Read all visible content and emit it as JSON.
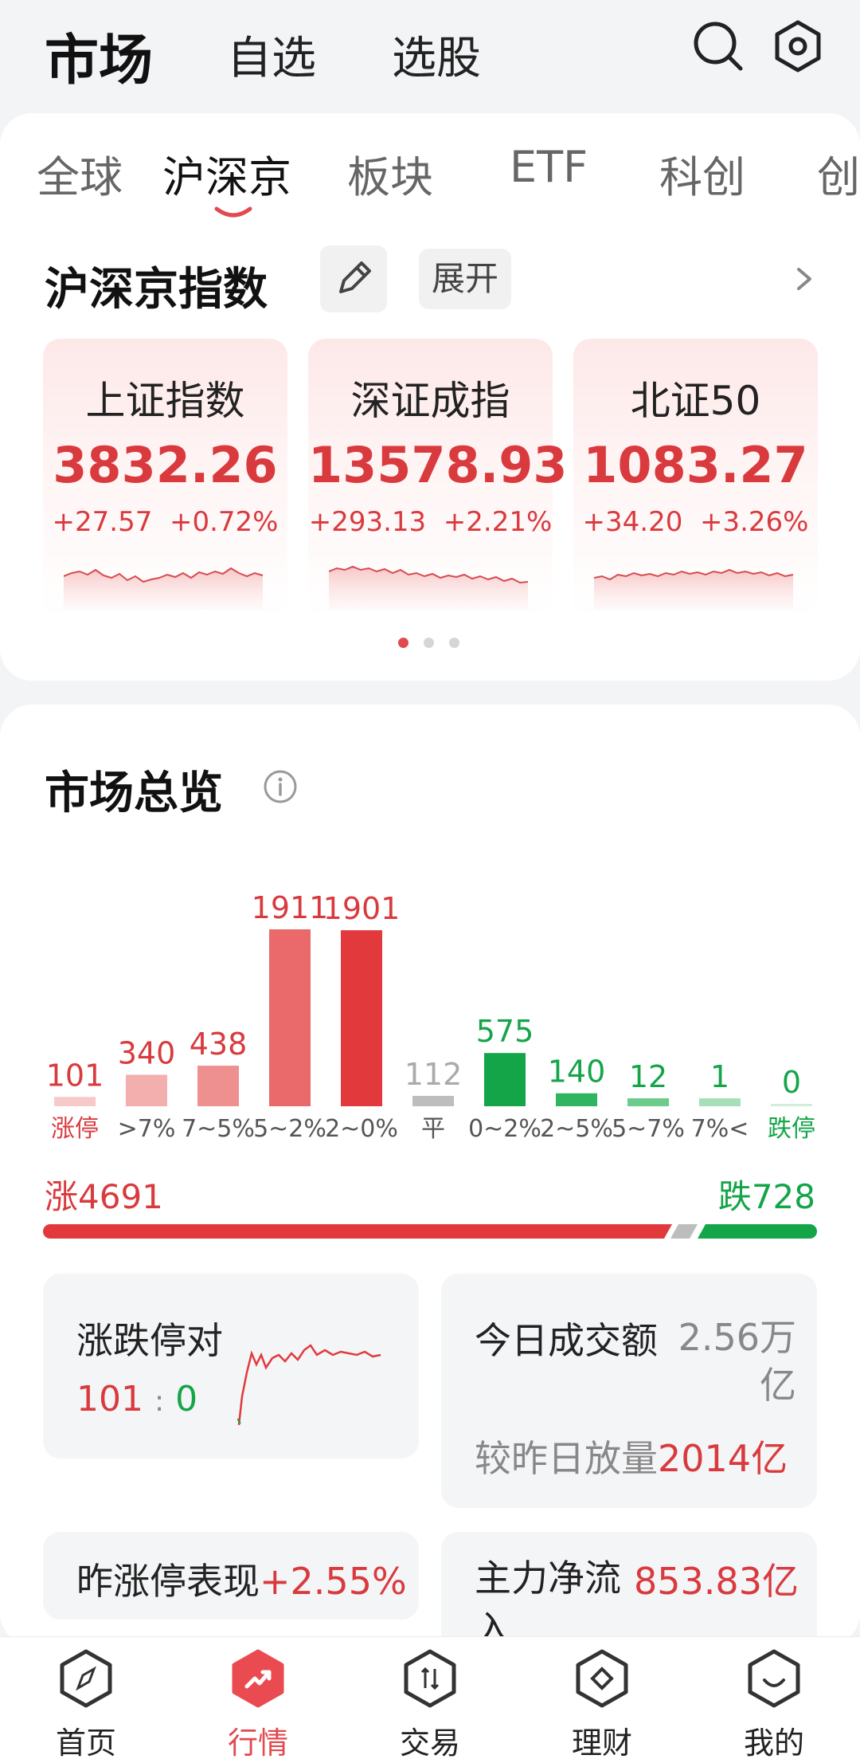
{
  "header": {
    "title": "市场",
    "nav": [
      "自选",
      "选股"
    ],
    "icons": [
      "search-icon",
      "settings-icon"
    ]
  },
  "tabs": [
    "全球",
    "沪深京",
    "板块",
    "ETF",
    "科创",
    "创"
  ],
  "active_tab": "沪深京",
  "index_section": {
    "title": "沪深京指数",
    "expand_label": "展开",
    "cards": [
      {
        "name": "上证指数",
        "value": "3832.26",
        "change": "+27.57",
        "pct": "+0.72%"
      },
      {
        "name": "深证成指",
        "value": "13578.93",
        "change": "+293.13",
        "pct": "+2.21%"
      },
      {
        "name": "北证50",
        "value": "1083.27",
        "change": "+34.20",
        "pct": "+3.26%"
      }
    ],
    "page_dots": 3,
    "active_dot": 0
  },
  "overview": {
    "title": "市场总览",
    "distribution": [
      {
        "label": "涨停",
        "value": "101",
        "color": "#f7c9c9"
      },
      {
        "label": ">7%",
        "value": "340",
        "color": "#f3aeae"
      },
      {
        "label": "7~5%",
        "value": "438",
        "color": "#ee8f90"
      },
      {
        "label": "5~2%",
        "value": "1911",
        "color": "#ea6a6c"
      },
      {
        "label": "2~0%",
        "value": "1901",
        "color": "#e2393d"
      },
      {
        "label": "平",
        "value": "112",
        "color": "#bdbdbd"
      },
      {
        "label": "0~2%",
        "value": "575",
        "color": "#14a549"
      },
      {
        "label": "2~5%",
        "value": "140",
        "color": "#2fb560"
      },
      {
        "label": "5~7%",
        "value": "12",
        "color": "#6ccc8c"
      },
      {
        "label": "7%<",
        "value": "1",
        "color": "#a6e0b9"
      },
      {
        "label": "跌停",
        "value": "0",
        "color": "#cfeed9"
      }
    ],
    "up_label": "涨4691",
    "down_label": "跌728",
    "limit_card": {
      "title": "涨跌停对",
      "up": "101",
      "sep": ":",
      "down": "0"
    },
    "turnover_card": {
      "title": "今日成交额",
      "value": "2.56万亿",
      "compare_label": "较昨日放量",
      "compare_value": "2014亿"
    },
    "prev_limit_card": {
      "title": "昨涨停表现",
      "value": "+2.55%"
    },
    "main_flow_card": {
      "title": "主力净流入",
      "value": "853.83亿"
    }
  },
  "bottom_nav": [
    {
      "label": "首页",
      "icon": "compass-icon"
    },
    {
      "label": "行情",
      "icon": "trend-icon"
    },
    {
      "label": "交易",
      "icon": "trade-icon"
    },
    {
      "label": "理财",
      "icon": "wealth-icon"
    },
    {
      "label": "我的",
      "icon": "profile-icon"
    }
  ],
  "active_nav": "行情",
  "colors": {
    "up": "#d93a3e",
    "down": "#14a549",
    "accent": "#e14a4f"
  }
}
